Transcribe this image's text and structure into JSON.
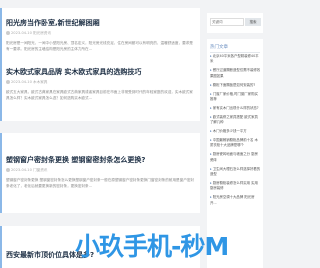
{
  "articles": [
    {
      "title": "阳光房当作卧室,新世纪解困厢",
      "meta": "2023-04-10   阳光房资讯",
      "excerpt": "阳光房是一间阳光，一间中小型阳光房、顶名定义，阳光房光线充足，住在房间都可以有明亮的、温暖舒适度，要求是有一要求。阳光房的主墙结构是阳光房的主体力所在..."
    },
    {
      "title": "实木欧式家具品牌 实木欧式家具的选购技巧",
      "meta": "2023-04-10   木木家具",
      "excerpt": "欧式五大家具，欧式古典家具在家具欧式古典家具或者家具目前在市面上非常受到时代的年轻家庭的欢迎，实木欧式家具怎么样？实木欧式家具怎么选？如何选购实木欧式..."
    },
    {
      "title": "塑钢窗户密封条更换 塑钢窗密封条怎么更换?",
      "meta": "2023-04-10   门窗资讯",
      "excerpt": "塑钢窗户密封条更换 塑钢窗密封条怎么更换塑钢窗户密封条一般在原塑钢窗户密封条更换门窗密封条的耐用是窗户密封条老化了，老化后就要更换新的密封条，更换密封条..."
    },
    {
      "title": "西安最新市顶价位具体是多?",
      "meta": "",
      "excerpt": ""
    }
  ],
  "sidebar": {
    "search_placeholder": "关键词",
    "search_button": "搜索",
    "hot_title": "热门文章",
    "hot_items": [
      "北京40平米各户型精装修40平米",
      "餐厅过道隔断造型仅需不装修效果图如果",
      "橱柜下面隔板是如何安装的?",
      "门窗厂家价格,时门窗厂家购买推荐",
      "家有实木门出现什么样的状态?",
      "欧式装修之家具搭配 欧式家具了解几种",
      "木门价格多少钱一平方",
      "中国最畅销橱柜品牌前十名 木质衣柜十大品牌是哪个",
      "厨房瓷砖地面与墙面之分 厨房瓷砖",
      "卫生间大理石怎么样选择好看的造型",
      "厨房橱柜装修怎么样实用 实用厨房装修",
      "阳光房空调十大品牌 阳光房开..."
    ]
  },
  "banner_text": "小玖手机-秒M"
}
